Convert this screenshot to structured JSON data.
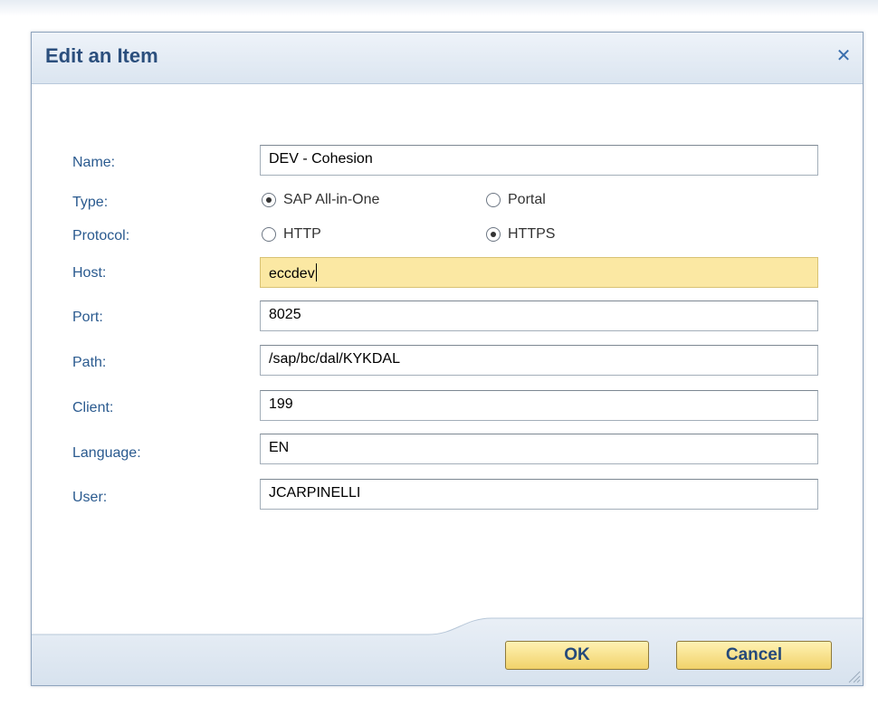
{
  "dialog": {
    "title": "Edit an Item",
    "close_icon": "close-icon",
    "close_symbol": "✕"
  },
  "form": {
    "name": {
      "label": "Name:",
      "value": "DEV - Cohesion"
    },
    "type": {
      "label": "Type:",
      "options": [
        "SAP All-in-One",
        "Portal"
      ],
      "selected": "SAP All-in-One"
    },
    "protocol": {
      "label": "Protocol:",
      "options": [
        "HTTP",
        "HTTPS"
      ],
      "selected": "HTTPS"
    },
    "host": {
      "label": "Host:",
      "value": "eccdev"
    },
    "port": {
      "label": "Port:",
      "value": "8025"
    },
    "path": {
      "label": "Path:",
      "value": "/sap/bc/dal/KYKDAL"
    },
    "client": {
      "label": "Client:",
      "value": "199"
    },
    "language": {
      "label": "Language:",
      "value": "EN"
    },
    "user": {
      "label": "User:",
      "value": "JCARPINELLI"
    }
  },
  "buttons": {
    "ok": "OK",
    "cancel": "Cancel"
  },
  "colors": {
    "accent_text": "#2a5a8f",
    "title_text": "#2b4f7d",
    "focused_field": "#fbe8a3",
    "button_fill": "#f1d26a"
  }
}
